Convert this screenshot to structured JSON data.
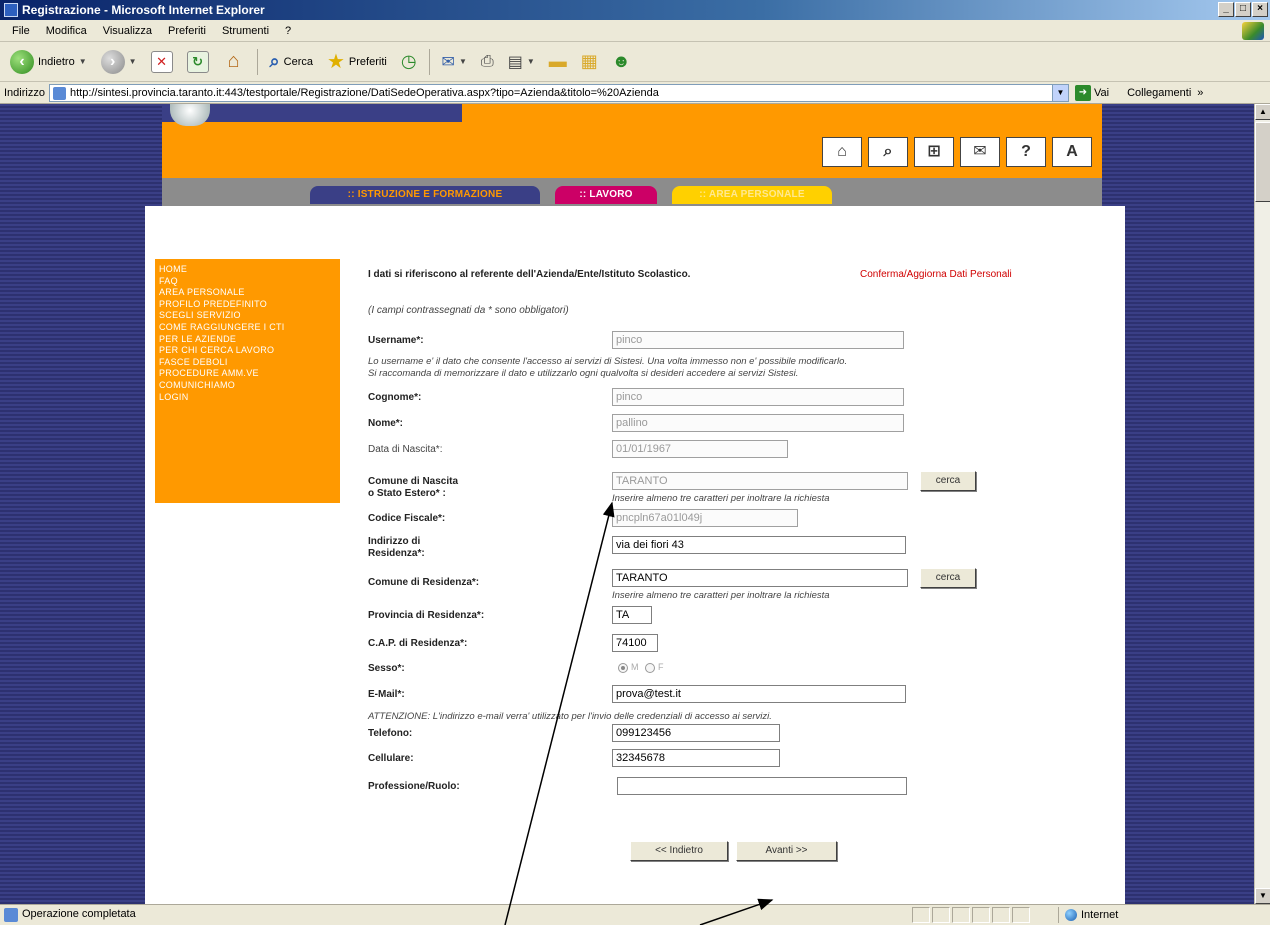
{
  "window": {
    "title": "Registrazione - Microsoft Internet Explorer",
    "buttons": [
      "_",
      "□",
      "×"
    ]
  },
  "menubar": {
    "items": [
      "File",
      "Modifica",
      "Visualizza",
      "Preferiti",
      "Strumenti",
      "?"
    ]
  },
  "toolbar": {
    "back_label": "Indietro",
    "search_label": "Cerca",
    "favorites_label": "Preferiti"
  },
  "addressbar": {
    "label": "Indirizzo",
    "url": "http://sintesi.provincia.taranto.it:443/testportale/Registrazione/DatiSedeOperativa.aspx?tipo=Azienda&titolo=%20Azienda",
    "go_label": "Vai",
    "links_label": "Collegamenti",
    "links_chevron": "»"
  },
  "page_tabs": {
    "istruzione": ":: ISTRUZIONE E FORMAZIONE",
    "lavoro": ":: LAVORO",
    "area_personale": ":: AREA PERSONALE"
  },
  "left_menu": {
    "items": [
      "HOME",
      "FAQ",
      "AREA PERSONALE",
      "PROFILO PREDEFINITO",
      "SCEGLI SERVIZIO",
      "COME RAGGIUNGERE I CTI",
      "PER LE AZIENDE",
      "PER CHI CERCA LAVORO",
      "FASCE DEBOLI",
      "PROCEDURE AMM.VE",
      "COMUNICHIAMO",
      "LOGIN"
    ]
  },
  "form": {
    "intro_text": "I dati si riferiscono al referente dell'Azienda/Ente/Istituto Scolastico.",
    "intro_link": "Conferma/Aggiorna Dati Personali",
    "required_note": "(I campi contrassegnati da * sono obbligatori)",
    "username_label": "Username*:",
    "username_value": "pinco",
    "username_note_1": "Lo username e' il dato che consente l'accesso ai servizi di Sistesi. Una volta immesso non e' possibile modificarlo.",
    "username_note_2": "Si raccomanda di memorizzare il dato e utilizzarlo ogni qualvolta si desideri accedere ai servizi Sistesi.",
    "cognome_label": "Cognome*:",
    "cognome_value": "pinco",
    "nome_label": "Nome*:",
    "nome_value": "pallino",
    "data_nascita_label": "Data di Nascita*:",
    "data_nascita_value": "01/01/1967",
    "comune_nascita_label_1": "Comune di Nascita",
    "comune_nascita_label_2": "o Stato Estero* :",
    "comune_nascita_value": "TARANTO",
    "cerca_label": "cerca",
    "cerca_hint": "Inserire almeno tre caratteri per inoltrare la richiesta",
    "codice_fiscale_label": "Codice Fiscale*:",
    "codice_fiscale_value": "pncpln67a01l049j",
    "indirizzo_label_1": "Indirizzo di",
    "indirizzo_label_2": "Residenza*:",
    "indirizzo_value": "via dei fiori 43",
    "comune_residenza_label": "Comune di Residenza*:",
    "comune_residenza_value": "TARANTO",
    "provincia_label": "Provincia di Residenza*:",
    "provincia_value": "TA",
    "cap_label": "C.A.P. di Residenza*:",
    "cap_value": "74100",
    "sesso_label": "Sesso*:",
    "sesso_m": "M",
    "sesso_f": "F",
    "email_label": "E-Mail*:",
    "email_value": "prova@test.it",
    "attenzione_note": "ATTENZIONE: L'indirizzo e-mail verra' utilizzato per l'invio delle credenziali di accesso ai servizi.",
    "telefono_label": "Telefono:",
    "telefono_value": "099123456",
    "cellulare_label": "Cellulare:",
    "cellulare_value": "32345678",
    "professione_label": "Professione/Ruolo:",
    "professione_value": "",
    "indietro_label": "<< Indietro",
    "avanti_label": "Avanti >>"
  },
  "statusbar": {
    "text": "Operazione completata",
    "zone": "Internet"
  },
  "colors": {
    "orange": "#ff9900",
    "navy": "#363a7c",
    "magenta": "#cc0066",
    "yellow": "#ffd000",
    "link_red": "#d00000"
  }
}
